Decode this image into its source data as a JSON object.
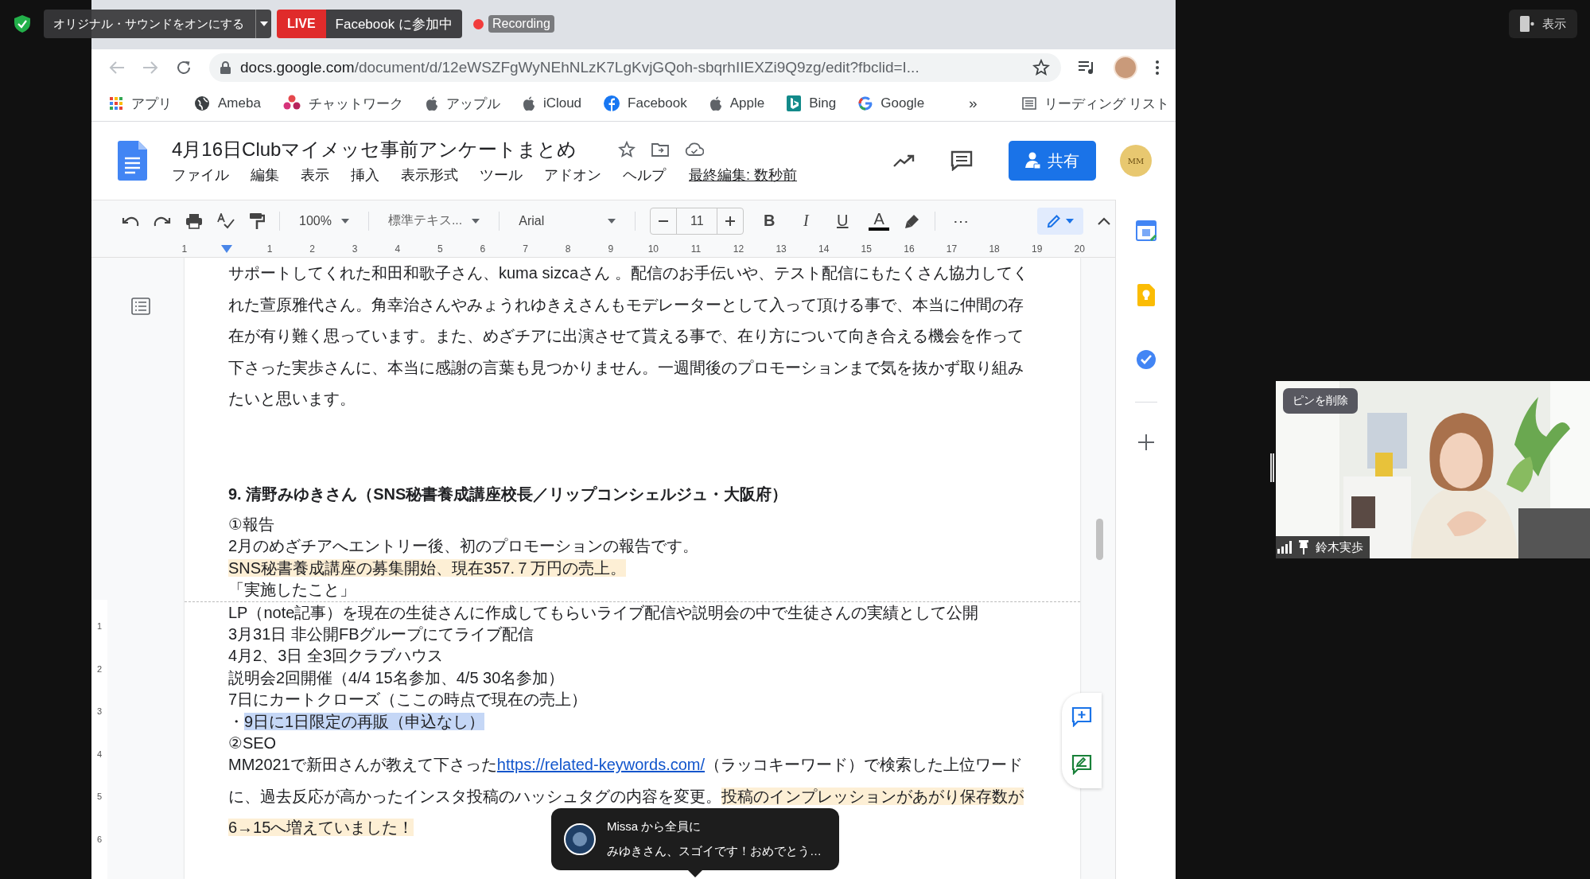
{
  "zoom_bar": {
    "audio_button": "オリジナル・サウンドをオンにする",
    "live_badge": "LIVE",
    "live_status": "Facebook に参加中",
    "recording": "Recording",
    "view_button": "表示"
  },
  "browser": {
    "url_host": "docs.google.com",
    "url_path": "/document/d/12eWSZFgWyNEhNLzK7LgKvjGQoh-sbqrhIIEXZi9Q9zg/edit?fbclid=I...",
    "bookmarks": [
      {
        "kind": "apps",
        "label": "アプリ"
      },
      {
        "kind": "globe",
        "label": "Ameba"
      },
      {
        "kind": "flower",
        "label": "チャットワーク"
      },
      {
        "kind": "apple",
        "label": "アップル"
      },
      {
        "kind": "apple",
        "label": "iCloud"
      },
      {
        "kind": "facebook",
        "label": "Facebook"
      },
      {
        "kind": "apple",
        "label": "Apple"
      },
      {
        "kind": "bing",
        "label": "Bing"
      },
      {
        "kind": "google",
        "label": "Google"
      }
    ],
    "overflow": "»",
    "reading_list": "リーディング リスト"
  },
  "doc": {
    "title": "4月16日Clubマイメッセ事前アンケートまとめ",
    "menu": [
      "ファイル",
      "編集",
      "表示",
      "挿入",
      "表示形式",
      "ツール",
      "アドオン",
      "ヘルプ"
    ],
    "last_edit": "最終編集: 数秒前",
    "share": "共有",
    "avatar_text": "MM"
  },
  "toolbar": {
    "zoom": "100%",
    "style": "標準テキス...",
    "font": "Arial",
    "font_size": "11",
    "bold": "B",
    "italic": "I",
    "underline": "U",
    "text_color": "A",
    "more": "⋯"
  },
  "ruler": {
    "left_label": "1",
    "labels": [
      "1",
      "2",
      "3",
      "4",
      "5",
      "6",
      "7",
      "8",
      "9",
      "10",
      "11",
      "12",
      "13",
      "14",
      "15",
      "16",
      "17",
      "18",
      "19",
      "20"
    ],
    "vertical_labels": [
      "1",
      "2",
      "3",
      "4",
      "5",
      "6"
    ]
  },
  "body": [
    {
      "kind": "paragraph",
      "segments": [
        {
          "kind": "plain",
          "text": "サポートしてくれた和田和歌子さん、kuma sizcaさん 。配信のお手伝いや、テスト配信にもたくさん協力してくれた萱原雅代さん。角幸治さんやみょうれゆきえさんもモデレーターとして入って頂ける事で、本当に仲間の存在が有り難く思っています。また、めざチアに出演させて貰える事で、在り方について向き合える機会を作って下さった実歩さんに、本当に感謝の言葉も見つかりません。一週間後のプロモーションまで気を抜かず取り組みたいと思います。"
        }
      ]
    },
    {
      "kind": "heading",
      "segments": [
        {
          "kind": "plain",
          "text": "9. 清野みゆきさん（SNS秘書養成講座校長／リップコンシェルジュ・大阪府）"
        }
      ]
    },
    {
      "kind": "line",
      "segments": [
        {
          "kind": "plain",
          "text": "①報告"
        }
      ]
    },
    {
      "kind": "line",
      "segments": [
        {
          "kind": "plain",
          "text": "2月のめざチアへエントリー後、初のプロモーションの報告です。"
        }
      ]
    },
    {
      "kind": "line",
      "segments": [
        {
          "kind": "highlight",
          "text": "SNS秘書養成講座の募集開始、現在357.７万円の売上。"
        }
      ]
    },
    {
      "kind": "line",
      "segments": [
        {
          "kind": "plain",
          "text": "「実施したこと」"
        }
      ]
    },
    {
      "kind": "page_break"
    },
    {
      "kind": "line",
      "segments": [
        {
          "kind": "plain",
          "text": "LP（note記事）を現在の生徒さんに作成してもらいライブ配信や説明会の中で生徒さんの実績として公開"
        }
      ]
    },
    {
      "kind": "line",
      "segments": [
        {
          "kind": "plain",
          "text": "3月31日 非公開FBグループにてライブ配信"
        }
      ]
    },
    {
      "kind": "line",
      "segments": [
        {
          "kind": "plain",
          "text": "4月2、3日 全3回クラブハウス"
        }
      ]
    },
    {
      "kind": "line",
      "segments": [
        {
          "kind": "plain",
          "text": "説明会2回開催（4/4 15名参加、4/5 30名参加）"
        }
      ]
    },
    {
      "kind": "line",
      "segments": [
        {
          "kind": "plain",
          "text": "7日にカートクローズ（ここの時点で現在の売上）"
        }
      ]
    },
    {
      "kind": "line",
      "segments": [
        {
          "kind": "plain",
          "text": "・"
        },
        {
          "kind": "selection",
          "text": "9日に1日限定の再販（申込なし）"
        }
      ]
    },
    {
      "kind": "line",
      "segments": [
        {
          "kind": "plain",
          "text": "②SEO"
        }
      ]
    },
    {
      "kind": "paragraph",
      "segments": [
        {
          "kind": "plain",
          "text": "MM2021で新田さんが教えて下さった"
        },
        {
          "kind": "link",
          "text": "https://related-keywords.com/"
        },
        {
          "kind": "plain",
          "text": "（ラッコキーワード）で検索した上位ワードに、過去反応が高かったインスタ投稿のハッシュタグの内容を変更。"
        },
        {
          "kind": "highlight",
          "text": "投稿のインプレッションがあがり保存数が6→15へ増えていました！"
        }
      ]
    }
  ],
  "chat": {
    "sender": "Missa から全員に",
    "message": "みゆきさん、スゴイです！おめでとう…"
  },
  "video": {
    "pin_label": "ピンを削除",
    "name": "鈴木実歩"
  }
}
